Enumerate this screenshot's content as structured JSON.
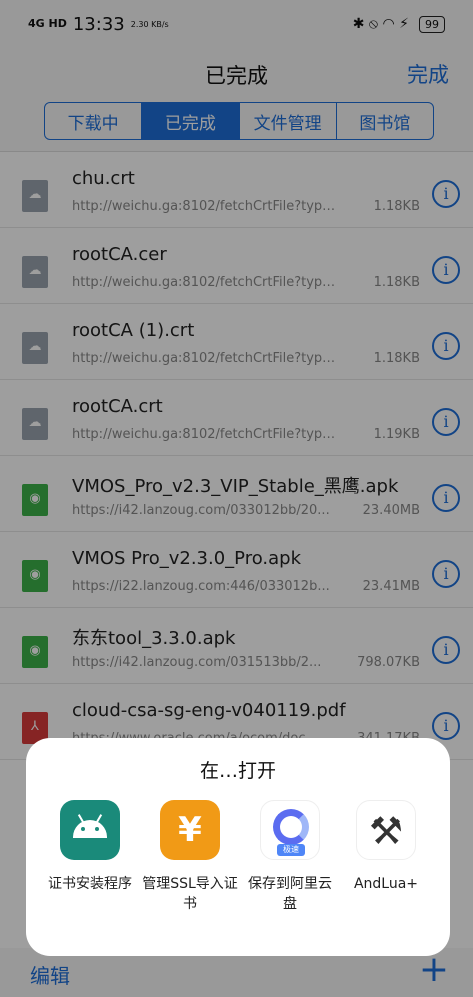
{
  "status": {
    "signal": "4G HD",
    "time": "13:33",
    "speed": "2.30 KB/s",
    "icons": "✱ ⦸ ◠ ⚡",
    "battery": "99"
  },
  "nav": {
    "title": "已完成",
    "done_label": "完成"
  },
  "segments": [
    {
      "label": "下载中",
      "active": false
    },
    {
      "label": "已完成",
      "active": true
    },
    {
      "label": "文件管理",
      "active": false
    },
    {
      "label": "图书馆",
      "active": false
    }
  ],
  "files": [
    {
      "name": "chu.crt",
      "url": "http://weichu.ga:8102/fetchCrtFile?type=...",
      "size": "1.18KB",
      "type": "cert"
    },
    {
      "name": "rootCA.cer",
      "url": "http://weichu.ga:8102/fetchCrtFile?type=...",
      "size": "1.18KB",
      "type": "cert"
    },
    {
      "name": "rootCA (1).crt",
      "url": "http://weichu.ga:8102/fetchCrtFile?type=...",
      "size": "1.18KB",
      "type": "cert"
    },
    {
      "name": "rootCA.crt",
      "url": "http://weichu.ga:8102/fetchCrtFile?type=...",
      "size": "1.19KB",
      "type": "cert"
    },
    {
      "name": "VMOS_Pro_v2.3_VIP_Stable_黑鹰.apk",
      "url": "https://i42.lanzoug.com/033012bb/20...",
      "size": "23.40MB",
      "type": "apk"
    },
    {
      "name": "VMOS Pro_v2.3.0_Pro.apk",
      "url": "https://i22.lanzoug.com:446/033012b...",
      "size": "23.41MB",
      "type": "apk"
    },
    {
      "name": "东东tool_3.3.0.apk",
      "url": "https://i42.lanzoug.com/031513bb/2...",
      "size": "798.07KB",
      "type": "apk"
    },
    {
      "name": "cloud-csa-sg-eng-v040119.pdf",
      "url": "https://www.oracle.com/a/ocom/doc...",
      "size": "341.17KB",
      "type": "pdf"
    }
  ],
  "bottom": {
    "edit_label": "编辑",
    "add_label": "+"
  },
  "sheet": {
    "title": "在…打开",
    "apps": [
      {
        "label": "证书安装程序",
        "icon": "android-icon"
      },
      {
        "label": "管理SSL导入证书",
        "icon": "eagle-icon"
      },
      {
        "label": "保存到阿里云盘",
        "icon": "aliyun-drive-icon",
        "tag": "极速"
      },
      {
        "label": "AndLua+",
        "icon": "tools-icon"
      }
    ]
  }
}
